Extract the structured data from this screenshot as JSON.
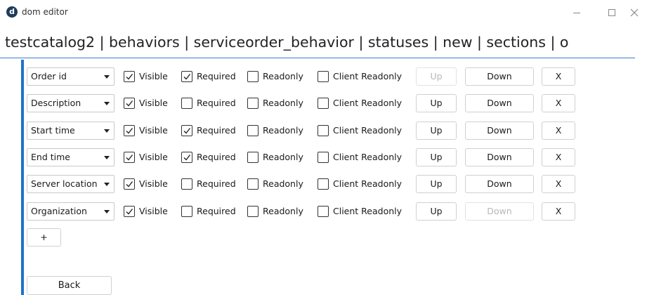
{
  "window": {
    "app_logo_letter": "d",
    "title": "dom editor",
    "minimize_icon": "minimize-icon",
    "maximize_icon": "maximize-icon",
    "close_icon": "close-icon"
  },
  "breadcrumb": {
    "text": "testcatalog2 | behaviors | serviceorder_behavior | statuses | new | sections | o"
  },
  "columns": {
    "visible_label": "Visible",
    "required_label": "Required",
    "readonly_label": "Readonly",
    "client_readonly_label": "Client Readonly",
    "up_label": "Up",
    "down_label": "Down",
    "remove_label": "X"
  },
  "rows": [
    {
      "field": "Order id",
      "visible": true,
      "required": true,
      "readonly": false,
      "client_readonly": false,
      "up_enabled": false,
      "down_enabled": true
    },
    {
      "field": "Description",
      "visible": true,
      "required": false,
      "readonly": false,
      "client_readonly": false,
      "up_enabled": true,
      "down_enabled": true
    },
    {
      "field": "Start time",
      "visible": true,
      "required": true,
      "readonly": false,
      "client_readonly": false,
      "up_enabled": true,
      "down_enabled": true
    },
    {
      "field": "End time",
      "visible": true,
      "required": true,
      "readonly": false,
      "client_readonly": false,
      "up_enabled": true,
      "down_enabled": true
    },
    {
      "field": "Server location",
      "visible": true,
      "required": false,
      "readonly": false,
      "client_readonly": false,
      "up_enabled": true,
      "down_enabled": true
    },
    {
      "field": "Organization",
      "visible": true,
      "required": false,
      "readonly": false,
      "client_readonly": false,
      "up_enabled": true,
      "down_enabled": false
    }
  ],
  "actions": {
    "add_label": "+",
    "back_label": "Back"
  },
  "colors": {
    "accent": "#1e73c8",
    "logo_bg": "#1f3a5c",
    "disabled_text": "#b7b7b7"
  }
}
